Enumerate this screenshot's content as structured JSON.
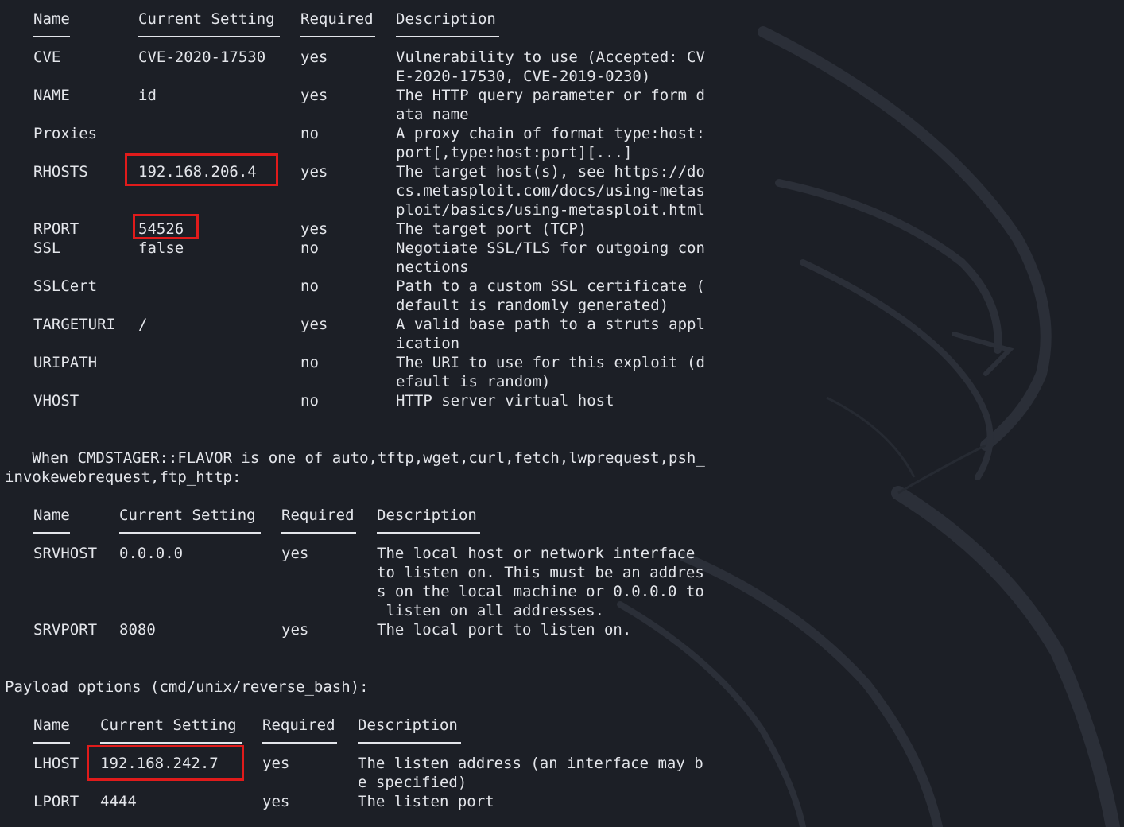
{
  "colors": {
    "background": "#1c1f26",
    "text": "#e3e5ea",
    "highlight_box": "#e01b1b"
  },
  "module_options": {
    "headers": [
      "Name",
      "Current Setting",
      "Required",
      "Description"
    ],
    "rows": [
      {
        "name": "CVE",
        "setting": "CVE-2020-17530",
        "required": "yes",
        "desc": [
          "Vulnerability to use (Accepted: CV",
          "E-2020-17530, CVE-2019-0230)"
        ]
      },
      {
        "name": "NAME",
        "setting": "id",
        "required": "yes",
        "desc": [
          "The HTTP query parameter or form d",
          "ata name"
        ]
      },
      {
        "name": "Proxies",
        "setting": "",
        "required": "no",
        "desc": [
          "A proxy chain of format type:host:",
          "port[,type:host:port][...]"
        ]
      },
      {
        "name": "RHOSTS",
        "setting": "192.168.206.4",
        "required": "yes",
        "desc": [
          "The target host(s), see https://do",
          "cs.metasploit.com/docs/using-metas",
          "ploit/basics/using-metasploit.html"
        ]
      },
      {
        "name": "RPORT",
        "setting": "54526",
        "required": "yes",
        "desc": [
          "The target port (TCP)"
        ]
      },
      {
        "name": "SSL",
        "setting": "false",
        "required": "no",
        "desc": [
          "Negotiate SSL/TLS for outgoing con",
          "nections"
        ]
      },
      {
        "name": "SSLCert",
        "setting": "",
        "required": "no",
        "desc": [
          "Path to a custom SSL certificate (",
          "default is randomly generated)"
        ]
      },
      {
        "name": "TARGETURI",
        "setting": "/",
        "required": "yes",
        "desc": [
          "A valid base path to a struts appl",
          "ication"
        ]
      },
      {
        "name": "URIPATH",
        "setting": "",
        "required": "no",
        "desc": [
          "The URI to use for this exploit (d",
          "efault is random)"
        ]
      },
      {
        "name": "VHOST",
        "setting": "",
        "required": "no",
        "desc": [
          "HTTP server virtual host"
        ]
      }
    ]
  },
  "cmdstager_note": {
    "line1": "   When CMDSTAGER::FLAVOR is one of auto,tftp,wget,curl,fetch,lwprequest,psh_",
    "line2": "invokewebrequest,ftp_http:"
  },
  "srv_options": {
    "headers": [
      "Name",
      "Current Setting",
      "Required",
      "Description"
    ],
    "rows": [
      {
        "name": "SRVHOST",
        "setting": "0.0.0.0",
        "required": "yes",
        "desc": [
          "The local host or network interface",
          "to listen on. This must be an addres",
          "s on the local machine or 0.0.0.0 to",
          " listen on all addresses."
        ]
      },
      {
        "name": "SRVPORT",
        "setting": "8080",
        "required": "yes",
        "desc": [
          "The local port to listen on."
        ]
      }
    ]
  },
  "payload_title": "Payload options (cmd/unix/reverse_bash):",
  "payload_options": {
    "headers": [
      "Name",
      "Current Setting",
      "Required",
      "Description"
    ],
    "rows": [
      {
        "name": "LHOST",
        "setting": "192.168.242.7",
        "required": "yes",
        "desc": [
          "The listen address (an interface may b",
          "e specified)"
        ]
      },
      {
        "name": "LPORT",
        "setting": "4444",
        "required": "yes",
        "desc": [
          "The listen port"
        ]
      }
    ]
  },
  "highlighted": [
    "RHOSTS",
    "RPORT",
    "LHOST"
  ]
}
